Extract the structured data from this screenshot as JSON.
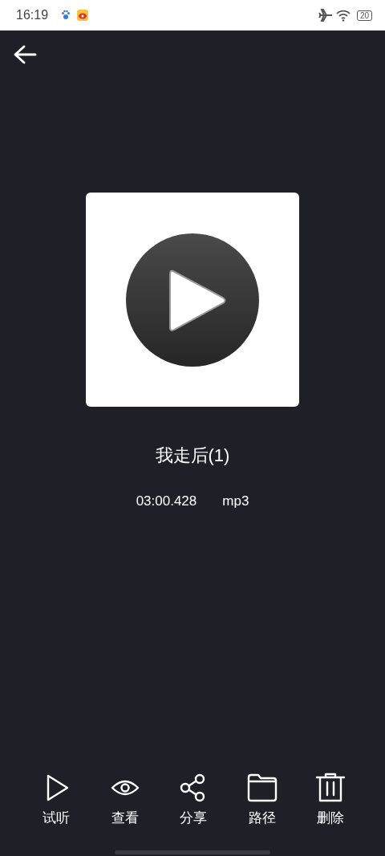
{
  "status_bar": {
    "time": "16:19",
    "battery": "20"
  },
  "track": {
    "title": "我走后(1)",
    "duration": "03:00.428",
    "format": "mp3"
  },
  "actions": [
    {
      "kind": "play",
      "label": "试听"
    },
    {
      "kind": "view",
      "label": "查看"
    },
    {
      "kind": "share",
      "label": "分享"
    },
    {
      "kind": "folder",
      "label": "路径"
    },
    {
      "kind": "delete",
      "label": "删除"
    }
  ]
}
